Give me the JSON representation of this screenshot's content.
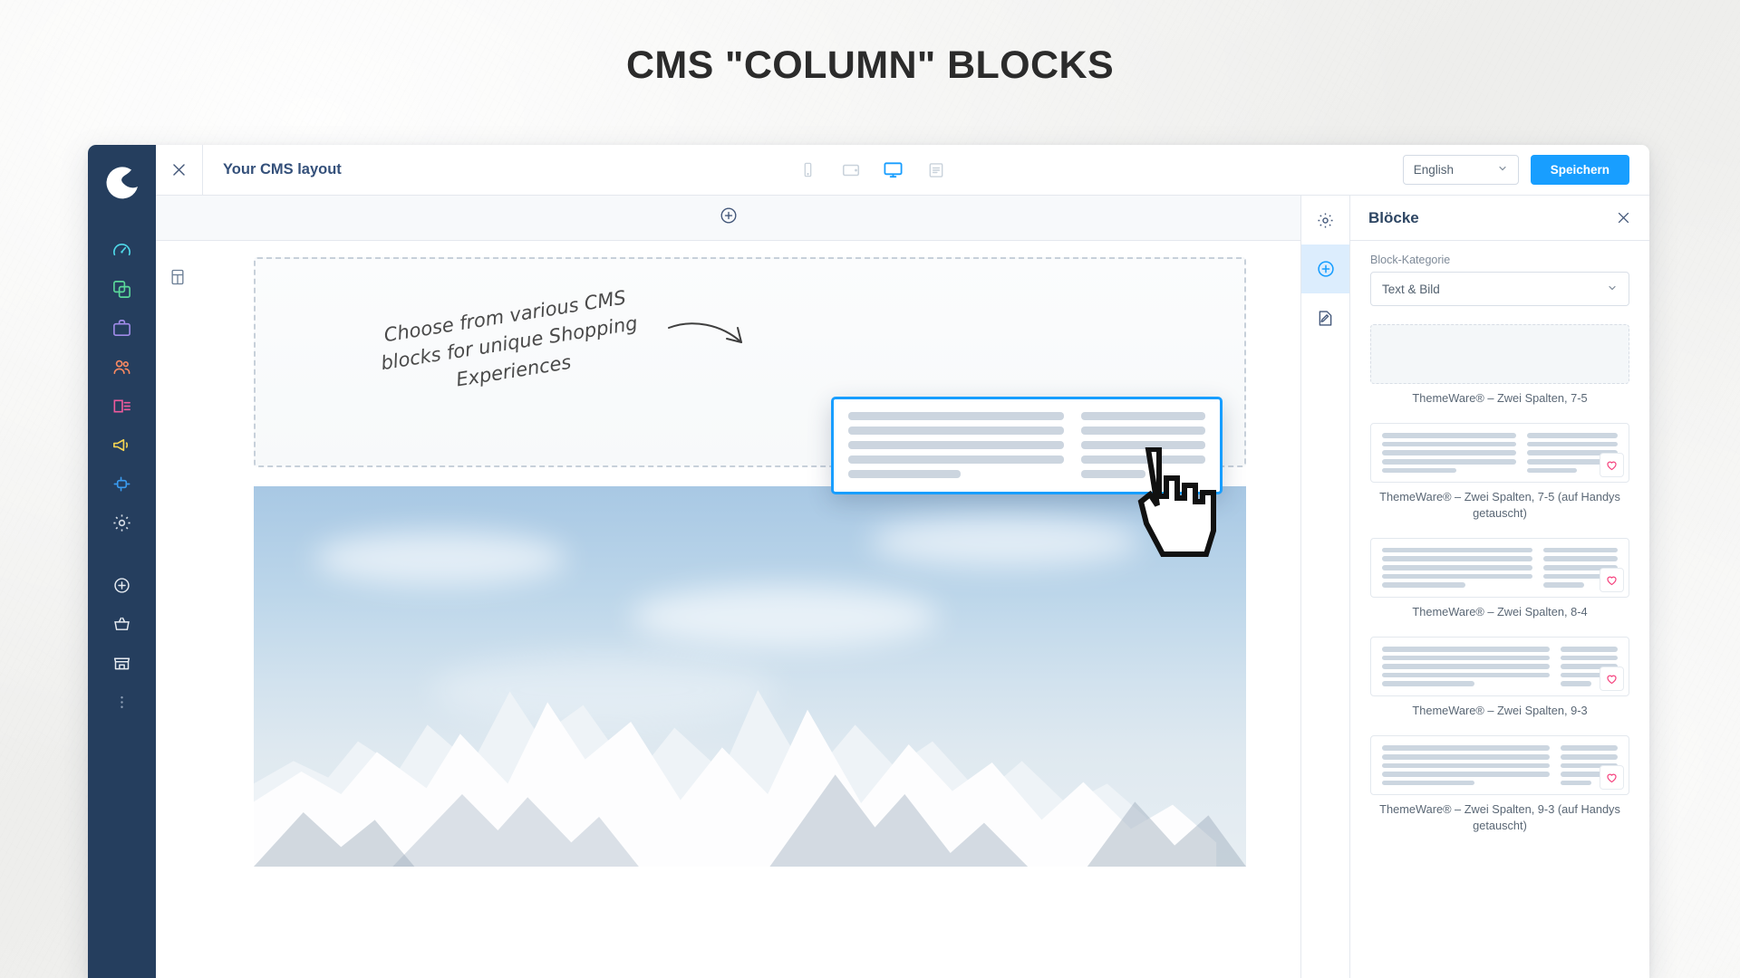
{
  "headline": "CMS \"COLUMN\" BLOCKS",
  "window": {
    "rail": {
      "logo_icon": "shopware-logo-icon",
      "items": [
        {
          "icon": "dashboard-icon",
          "color": "#4FD7E8"
        },
        {
          "icon": "catalogue-icon",
          "color": "#5BD89A"
        },
        {
          "icon": "orders-icon",
          "color": "#A08BE8"
        },
        {
          "icon": "customers-icon",
          "color": "#F88962"
        },
        {
          "icon": "content-icon",
          "color": "#EE5A9C"
        },
        {
          "icon": "marketing-icon",
          "color": "#F6D552"
        },
        {
          "icon": "extensions-icon",
          "color": "#3A9BF0"
        },
        {
          "icon": "settings-gear-icon",
          "color": "#D6DDE6"
        }
      ],
      "bottom_items": [
        {
          "icon": "plus-circle-icon",
          "color": "#E6EBF1"
        },
        {
          "icon": "basket-icon",
          "color": "#E6EBF1"
        },
        {
          "icon": "store-icon",
          "color": "#E6EBF1"
        },
        {
          "icon": "more-dots-icon",
          "color": "#8FA0B6"
        }
      ]
    },
    "topbar": {
      "close_icon": "close-icon",
      "title": "Your CMS layout",
      "devices": [
        {
          "icon": "mobile-icon",
          "active": false
        },
        {
          "icon": "tablet-icon",
          "active": false
        },
        {
          "icon": "desktop-icon",
          "active": true
        },
        {
          "icon": "list-view-icon",
          "active": false
        }
      ],
      "language": "English",
      "language_caret_icon": "chevron-down-icon",
      "save_label": "Speichern",
      "save_color": "#189EFF"
    },
    "canvas": {
      "add_section_icon": "plus-circle-icon",
      "gutter_icon": "section-layout-icon",
      "note": "Choose from various CMS blocks for unique Shopping Experiences",
      "drag_block": {
        "name": "two-column-block-ghost",
        "border_color": "#189EFF",
        "left_lines": 4,
        "left_short_line": true,
        "right_lines": 4,
        "right_short_line": true
      },
      "cursor_icon": "pointing-hand-cursor-icon"
    },
    "right_strip": [
      {
        "icon": "gear-icon",
        "active": false
      },
      {
        "icon": "plus-circle-icon",
        "active": true
      },
      {
        "icon": "edit-layout-icon",
        "active": false
      }
    ],
    "panel": {
      "title": "Blöcke",
      "close_icon": "close-icon",
      "category_label": "Block-Kategorie",
      "category_value": "Text & Bild",
      "category_caret_icon": "chevron-down-icon",
      "favorite_icon": "heart-icon",
      "favorite_color": "#F5427E",
      "blocks": [
        {
          "label": "ThemeWare® – Zwei Spalten, 7-5",
          "empty": true,
          "left_width": 0,
          "right_width": 0,
          "favorite": false
        },
        {
          "label": "ThemeWare® – Zwei Spalten, 7-5 (auf Handys getauscht)",
          "empty": false,
          "left_width": 57,
          "right_width": 43,
          "favorite": true
        },
        {
          "label": "ThemeWare® – Zwei Spalten, 8-4",
          "empty": false,
          "left_width": 64,
          "right_width": 36,
          "favorite": true
        },
        {
          "label": "ThemeWare® – Zwei Spalten, 9-3",
          "empty": false,
          "left_width": 71,
          "right_width": 29,
          "favorite": true
        },
        {
          "label": "ThemeWare® – Zwei Spalten, 9-3 (auf Handys getauscht)",
          "empty": false,
          "left_width": 71,
          "right_width": 29,
          "favorite": true
        }
      ]
    }
  }
}
